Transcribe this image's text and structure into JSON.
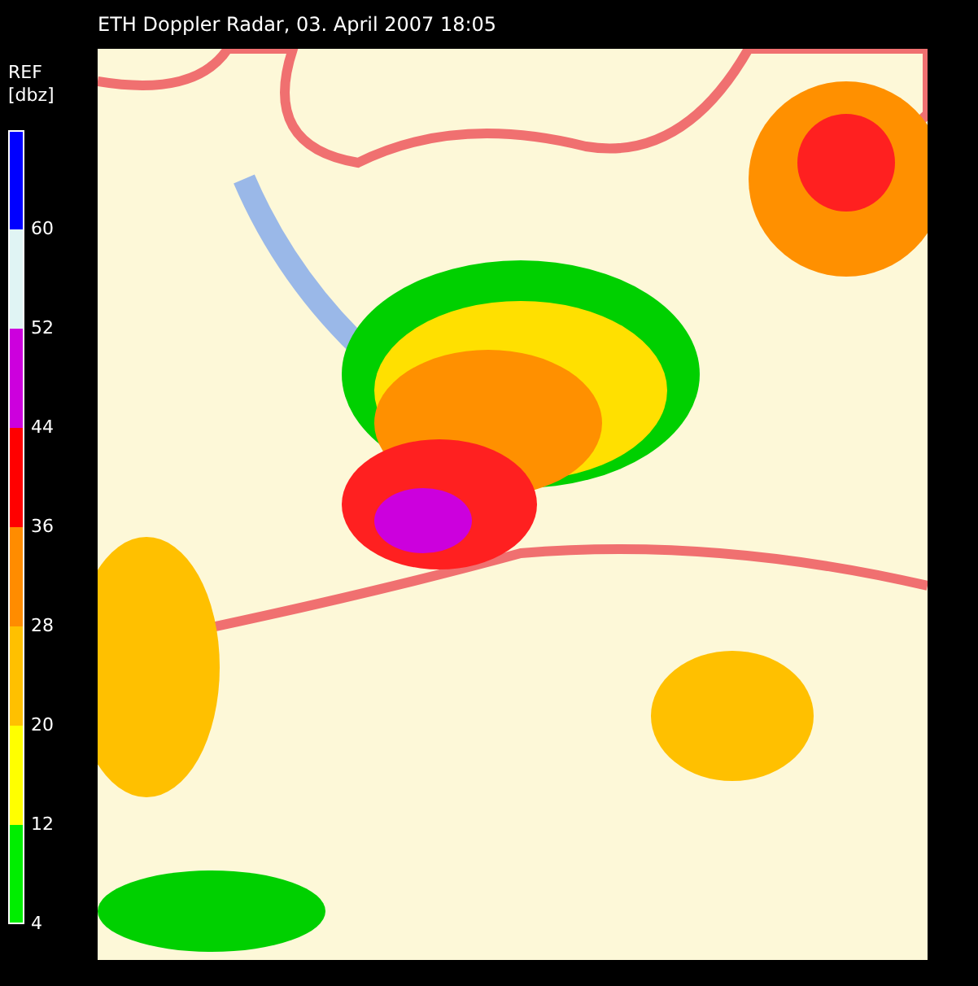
{
  "title": "ETH Doppler Radar, 03. April 2007 18:05",
  "legend": {
    "quantity": "REF",
    "unit": "[dbz]",
    "segments": [
      {
        "color": "#0000ff",
        "label": "60"
      },
      {
        "color": "#e0f4f4",
        "label": "52"
      },
      {
        "color": "#cc00dd",
        "label": "44"
      },
      {
        "color": "#ff0000",
        "label": "36"
      },
      {
        "color": "#ff8c00",
        "label": "28"
      },
      {
        "color": "#ffc000",
        "label": "20"
      },
      {
        "color": "#ffff00",
        "label": "12"
      },
      {
        "color": "#00ee00",
        "label": "4"
      }
    ]
  }
}
